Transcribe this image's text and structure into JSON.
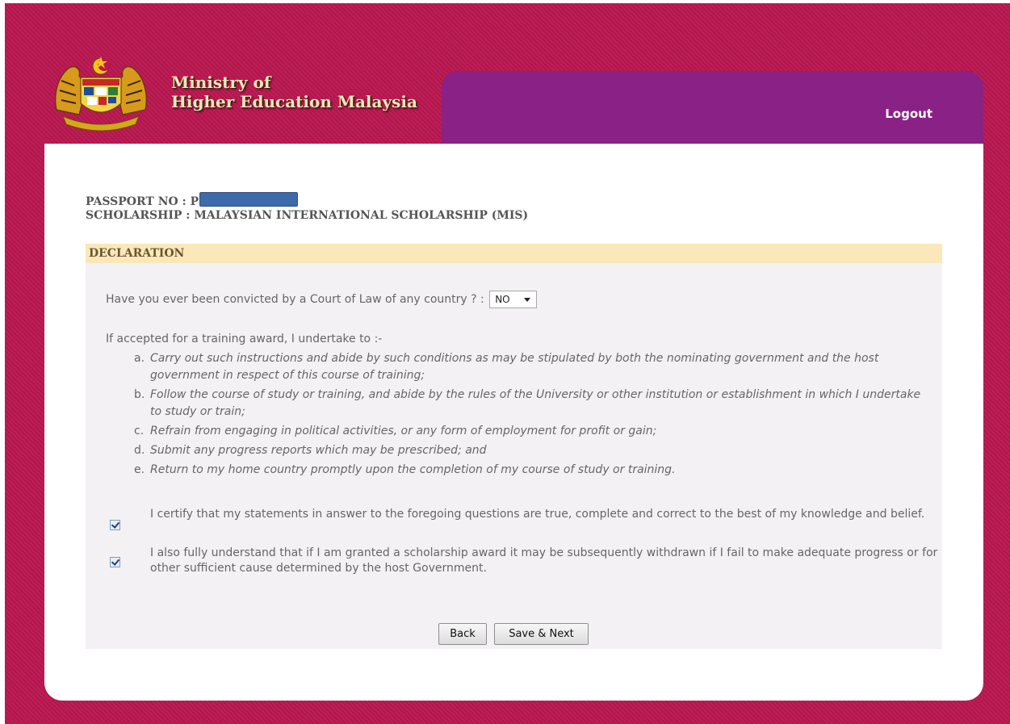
{
  "header": {
    "ministry_line1": "Ministry of",
    "ministry_line2": "Higher Education Malaysia",
    "logout_label": "Logout",
    "crest_icon": "malaysia-coat-of-arms-icon"
  },
  "info": {
    "passport_label": "PASSPORT NO :",
    "passport_prefix": "P",
    "scholarship_label": "SCHOLARSHIP :",
    "scholarship_value": "MALAYSIAN INTERNATIONAL SCHOLARSHIP (MIS)"
  },
  "declaration": {
    "header": "DECLARATION",
    "question": "Have you ever been convicted by a Court of Law of any country ? :",
    "conviction_value": "NO",
    "intro": "If accepted for a training award, I undertake to :-",
    "items": [
      {
        "letter": "a.",
        "text": "Carry out such instructions and abide by such conditions as may be stipulated by both the nominating government and the host government in respect of this course of training;"
      },
      {
        "letter": "b.",
        "text": "Follow the course of study or training, and abide by the rules of the University or other institution or establishment in which I undertake to study or train;"
      },
      {
        "letter": "c.",
        "text": "Refrain from engaging in political activities, or any form of employment for profit or gain;"
      },
      {
        "letter": "d.",
        "text": "Submit any progress reports which may be prescribed; and"
      },
      {
        "letter": "e.",
        "text": "Return to my home country promptly upon the completion of my course of study or training."
      }
    ],
    "certify_1": "I certify that my statements in answer to the foregoing questions are true, complete and correct to the best of my knowledge and belief.",
    "certify_2": "I also fully understand that if I am granted a scholarship award it may be subsequently withdrawn if I fail to make adequate progress or for other sufficient cause determined by the host Government.",
    "certify_1_checked": true,
    "certify_2_checked": true
  },
  "buttons": {
    "back": "Back",
    "save_next": "Save & Next"
  },
  "colors": {
    "background": "#b8174f",
    "topbar": "#8a2186",
    "header_band": "#fbe8b8",
    "panel_body": "#f4f1f5"
  }
}
